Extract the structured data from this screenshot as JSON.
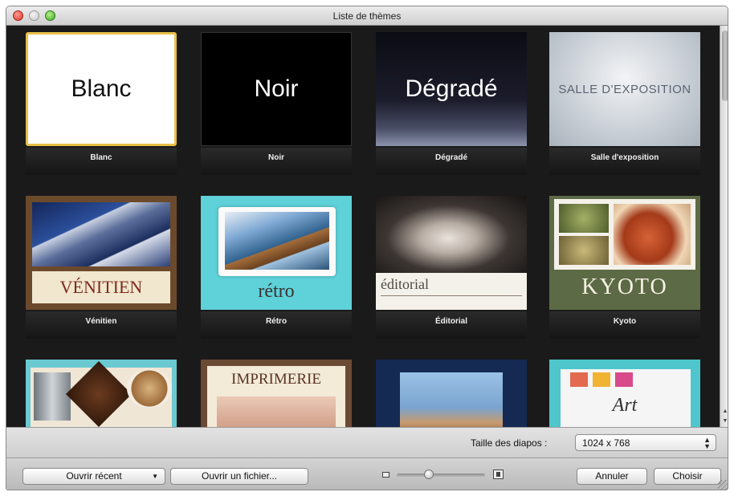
{
  "window": {
    "title": "Liste de thèmes"
  },
  "themes": [
    {
      "label": "Blanc",
      "thumb_text": "Blanc"
    },
    {
      "label": "Noir",
      "thumb_text": "Noir"
    },
    {
      "label": "Dégradé",
      "thumb_text": "Dégradé"
    },
    {
      "label": "Salle d'exposition",
      "thumb_text": "SALLE D'EXPOSITION"
    },
    {
      "label": "Vénitien",
      "thumb_text": "VÉNITIEN"
    },
    {
      "label": "Rétro",
      "thumb_text": "rétro"
    },
    {
      "label": "Éditorial",
      "thumb_text": "éditorial"
    },
    {
      "label": "Kyoto",
      "thumb_text": "KYOTO"
    },
    {
      "label": "",
      "thumb_text": ""
    },
    {
      "label": "",
      "thumb_text": "IMPRIMERIE"
    },
    {
      "label": "",
      "thumb_text": ""
    },
    {
      "label": "",
      "thumb_text": "Art"
    }
  ],
  "selected_theme": "Blanc",
  "size_row": {
    "label": "Taille des diapos :",
    "value": "1024 x 768"
  },
  "buttons": {
    "open_recent": "Ouvrir récent",
    "open_file": "Ouvrir un fichier...",
    "cancel": "Annuler",
    "choose": "Choisir"
  },
  "thumbnail_zoom": 0.35,
  "accent_colors": {
    "selection": "#e8c04a",
    "background": "#1a1a1a"
  }
}
